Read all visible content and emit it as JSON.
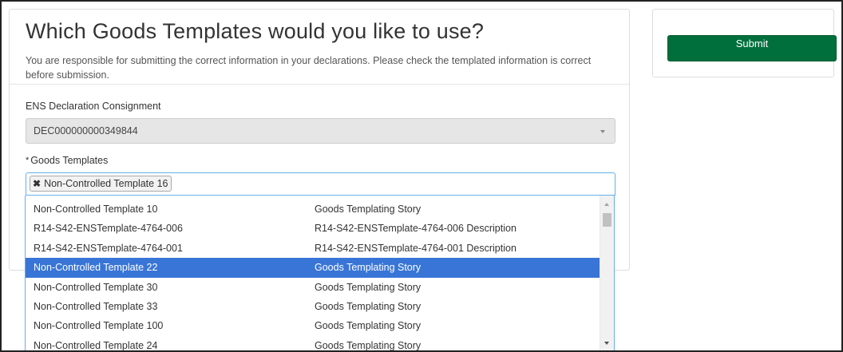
{
  "header": {
    "title": "Which Goods Templates would you like to use?",
    "subtitle": "You are responsible for submitting the correct information in your declarations. Please check the templated information is correct before submission."
  },
  "ens_field": {
    "label": "ENS Declaration Consignment",
    "value": "DEC000000000349844"
  },
  "goods_field": {
    "required_marker": "*",
    "label": "Goods Templates",
    "selected_tags": [
      {
        "remove_icon": "✖",
        "label": "Non-Controlled Template 16"
      }
    ]
  },
  "dropdown": {
    "options": [
      {
        "name": "Non-Controlled Template 10",
        "description": "Goods Templating Story",
        "highlighted": false
      },
      {
        "name": "R14-S42-ENSTemplate-4764-006",
        "description": "R14-S42-ENSTemplate-4764-006 Description",
        "highlighted": false
      },
      {
        "name": "R14-S42-ENSTemplate-4764-001",
        "description": "R14-S42-ENSTemplate-4764-001 Description",
        "highlighted": false
      },
      {
        "name": "Non-Controlled Template 22",
        "description": "Goods Templating Story",
        "highlighted": true
      },
      {
        "name": "Non-Controlled Template 30",
        "description": "Goods Templating Story",
        "highlighted": false
      },
      {
        "name": "Non-Controlled Template 33",
        "description": "Goods Templating Story",
        "highlighted": false
      },
      {
        "name": "Non-Controlled Template 100",
        "description": "Goods Templating Story",
        "highlighted": false
      },
      {
        "name": "Non-Controlled Template 24",
        "description": "Goods Templating Story",
        "highlighted": false
      }
    ]
  },
  "sidebar": {
    "submit_label": "Submit"
  },
  "colors": {
    "submit_green": "#006f3c",
    "highlight_blue": "#3875d7",
    "focus_border": "#66afe9"
  },
  "icons": {
    "ens_select_caret": "chevron-down-icon",
    "tag_remove": "close-icon",
    "scroll_up": "scroll-up-arrow-icon",
    "scroll_down": "scroll-down-arrow-icon"
  }
}
